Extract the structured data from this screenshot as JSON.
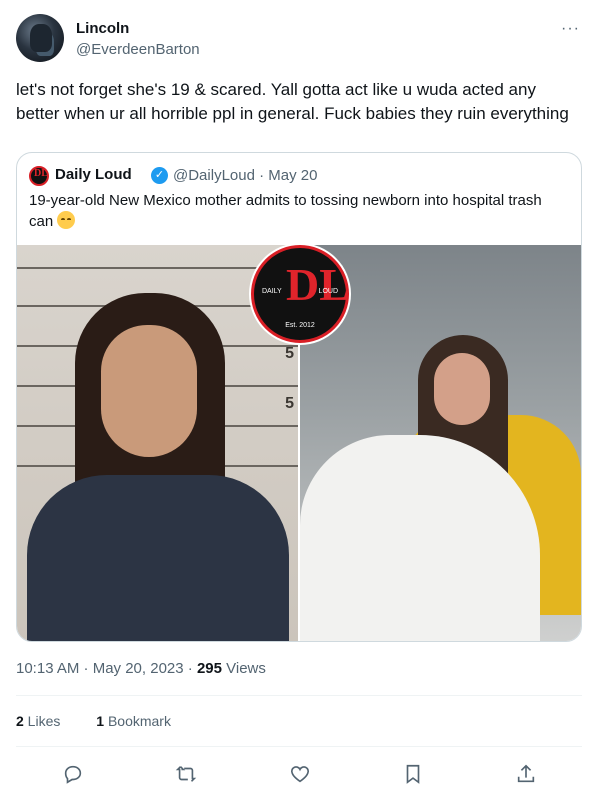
{
  "tweet": {
    "author_name": "Lincoln",
    "author_handle": "@EverdeenBarton",
    "more_label": "···",
    "text": "let's not forget she's 19 & scared. Yall gotta act like u wuda acted any better when ur all horrible ppl in general. Fuck babies they ruin everything",
    "timestamp": "10:13 AM · May 20, 2023",
    "separator": " · ",
    "views_count": "295",
    "views_label": " Views"
  },
  "quote": {
    "avatar_letter": "DL",
    "author_name": "Daily Loud",
    "author_handle": "@DailyLoud · May 20",
    "text": "19-year-old New Mexico mother admits to tossing newborn into hospital trash can",
    "logo": {
      "letters": "DL",
      "left": "DAILY",
      "right": "LOUD",
      "est": "Est. 2012"
    },
    "mugshot_numbers": [
      "5",
      "5"
    ]
  },
  "stats": {
    "likes_count": "2",
    "likes_label": " Likes",
    "bookmarks_count": "1",
    "bookmarks_label": " Bookmark"
  },
  "icons": {
    "reply": "reply-icon",
    "retweet": "retweet-icon",
    "like": "heart-icon",
    "bookmark": "bookmark-icon",
    "share": "share-icon"
  },
  "colors": {
    "verified": "#1d9bf0",
    "brand_red": "#d91f26",
    "secondary_text": "#536471"
  }
}
